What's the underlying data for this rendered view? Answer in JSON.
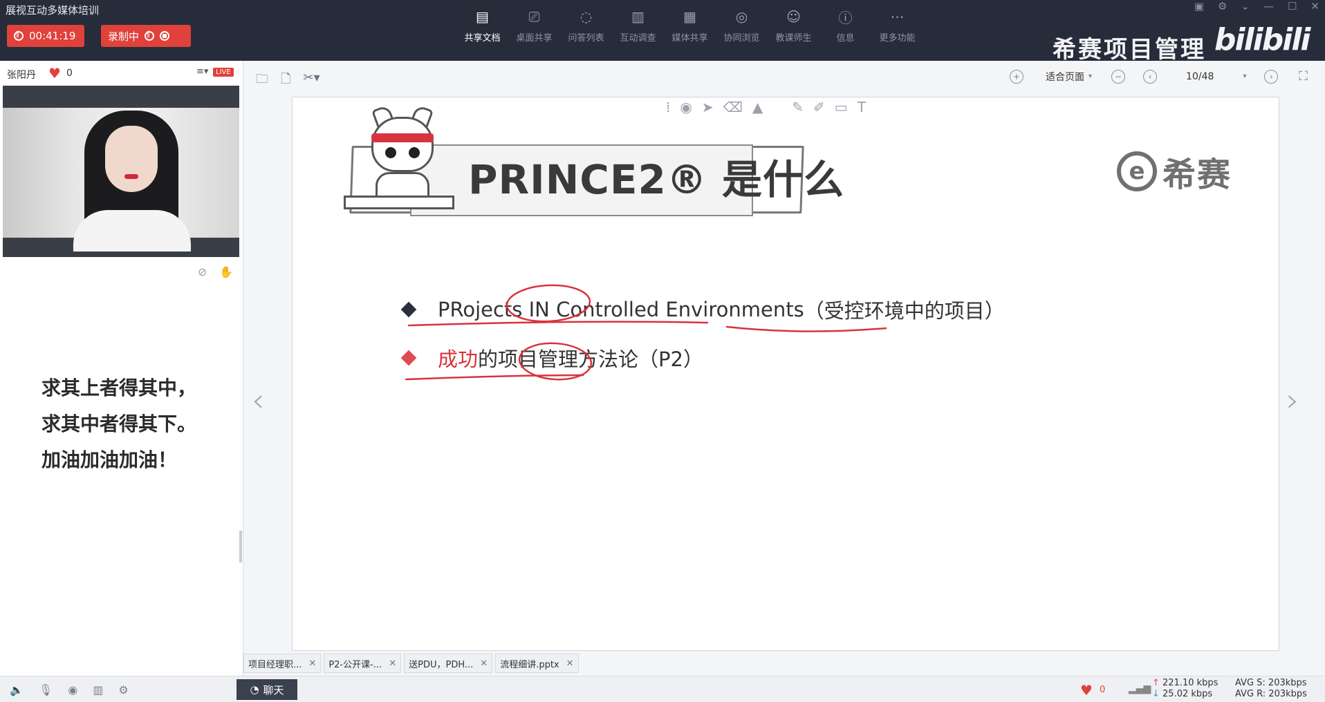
{
  "app": {
    "title": "展视互动多媒体培训"
  },
  "recording": {
    "timer": "00:41:19",
    "rec_label": "录制中"
  },
  "toolbar": {
    "items": [
      {
        "label": "共享文档",
        "icon": "document-share-icon",
        "glyph": "▤",
        "active": true
      },
      {
        "label": "桌面共享",
        "icon": "desktop-share-icon",
        "glyph": "⎚"
      },
      {
        "label": "问答列表",
        "icon": "qa-list-icon",
        "glyph": "◌"
      },
      {
        "label": "互动调查",
        "icon": "survey-chart-icon",
        "glyph": "▥"
      },
      {
        "label": "媒体共享",
        "icon": "media-share-icon",
        "glyph": "▦"
      },
      {
        "label": "协同浏览",
        "icon": "co-browse-icon",
        "glyph": "◎"
      },
      {
        "label": "教课师生",
        "icon": "users-icon",
        "glyph": "☺"
      },
      {
        "label": "信息",
        "icon": "info-icon",
        "glyph": "ⓘ"
      },
      {
        "label": "更多功能",
        "icon": "more-icon",
        "glyph": "⋯"
      }
    ]
  },
  "brand": {
    "text": "希赛项目管理",
    "watermark": "bilibili"
  },
  "host": {
    "name": "张阳丹",
    "likes": "0",
    "live": "LIVE"
  },
  "motto": {
    "line1": "求其上者得其中，",
    "line2": "求其中者得其下。",
    "line3": "加油加油加油！"
  },
  "viewer": {
    "fit": "适合页面",
    "page": "10/48"
  },
  "slide": {
    "title": "PRINCE2® 是什么",
    "logo_mark": "e",
    "logo_text": "希赛",
    "bullet1": {
      "text": "PRojects IN Controlled Environments",
      "note": "（受控环境中的项目）"
    },
    "bullet2": {
      "red": "成功",
      "rest": "的项目管理方法论",
      "note": "（P2）"
    }
  },
  "tabs": [
    {
      "label": "项目经理职..."
    },
    {
      "label": "P2-公开课-..."
    },
    {
      "label": "送PDU，PDH..."
    },
    {
      "label": "流程细讲.pptx"
    }
  ],
  "status": {
    "chat_label": "聊天",
    "likes": "0",
    "up_rate": "221.10 kbps",
    "down_rate": "25.02 kbps",
    "avg_s": "AVG S: 203kbps",
    "avg_r": "AVG R: 203kbps"
  },
  "colors": {
    "accent_red": "#e0413a",
    "topbar": "#262c3a",
    "annotation_red": "#d9323d"
  }
}
